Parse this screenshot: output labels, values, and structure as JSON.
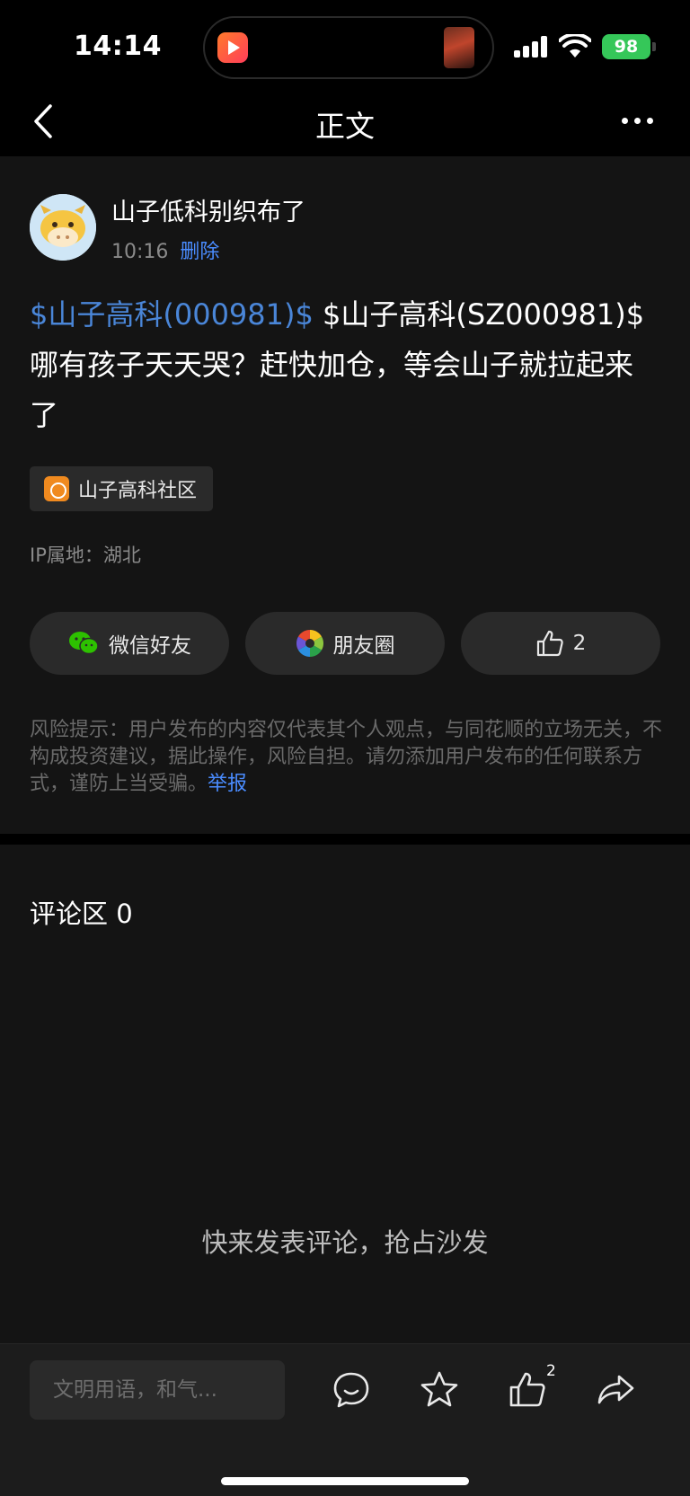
{
  "status_bar": {
    "time": "14:14",
    "battery": "98"
  },
  "nav": {
    "title": "正文"
  },
  "post": {
    "author": "山子低科别织布了",
    "time": "10:16",
    "delete_label": "删除",
    "stock_link": "$山子高科(000981)$",
    "text_rest": " $山子高科(SZ000981)$ 哪有孩子天天哭？赶快加仓，等会山子就拉起来了",
    "community_tag": "山子高科社区",
    "ip_location": "IP属地：湖北",
    "share_wechat_label": "微信好友",
    "share_moments_label": "朋友圈",
    "like_count": "2",
    "risk_text": "风险提示：用户发布的内容仅代表其个人观点，与同花顺的立场无关，不构成投资建议，据此操作，风险自担。请勿添加用户发布的任何联系方式，谨防上当受骗。",
    "report_label": "举报"
  },
  "comments": {
    "title": "评论区 0",
    "empty_text": "快来发表评论，抢占沙发"
  },
  "bottom_bar": {
    "input_placeholder": "文明用语，和气...",
    "like_badge": "2"
  },
  "icons": {
    "back": "chevron-left-icon",
    "more": "more-dots-icon",
    "wechat": "wechat-icon",
    "moments": "moments-icon",
    "like": "thumbs-up-icon",
    "comment": "comment-bubble-icon",
    "favorite": "star-icon",
    "share": "share-arrow-icon"
  },
  "colors": {
    "background": "#000000",
    "card": "#141414",
    "accent_link": "#4a8cff",
    "stock_link": "#4a86d8",
    "battery": "#35c759"
  }
}
